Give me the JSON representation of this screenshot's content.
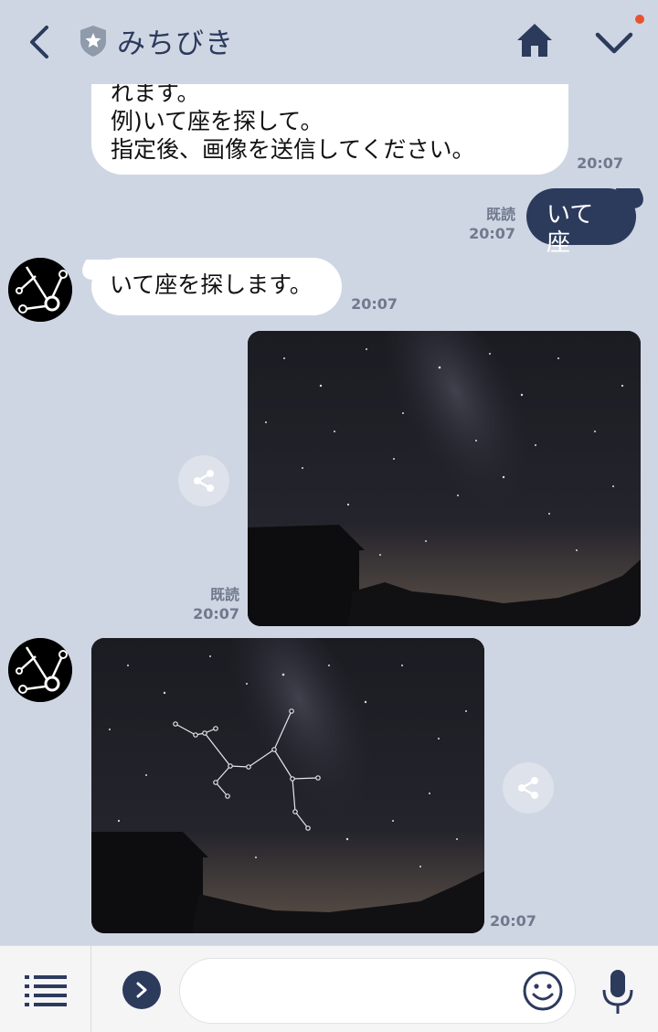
{
  "header": {
    "title": "みちびき",
    "icons": [
      "back-arrow-icon",
      "shield-star-icon",
      "home-icon",
      "chevron-down-icon"
    ],
    "accent": "#2c3a5c",
    "notification_color": "#e8522d"
  },
  "messages": {
    "m1": {
      "line1": "れます。",
      "line2": "例)いて座を探して。",
      "line3": "指定後、画像を送信してください。",
      "time": "20:07"
    },
    "m2": {
      "text": "いて座",
      "read": "既読",
      "time": "20:07"
    },
    "m3": {
      "text": "いて座を探します。",
      "time": "20:07"
    },
    "m4": {
      "read": "既読",
      "time": "20:07"
    },
    "m5": {
      "time": "20:07"
    }
  },
  "composer": {
    "placeholder": "",
    "icons": [
      "menu-list-icon",
      "chevron-right-icon",
      "emoji-icon",
      "microphone-icon"
    ]
  }
}
